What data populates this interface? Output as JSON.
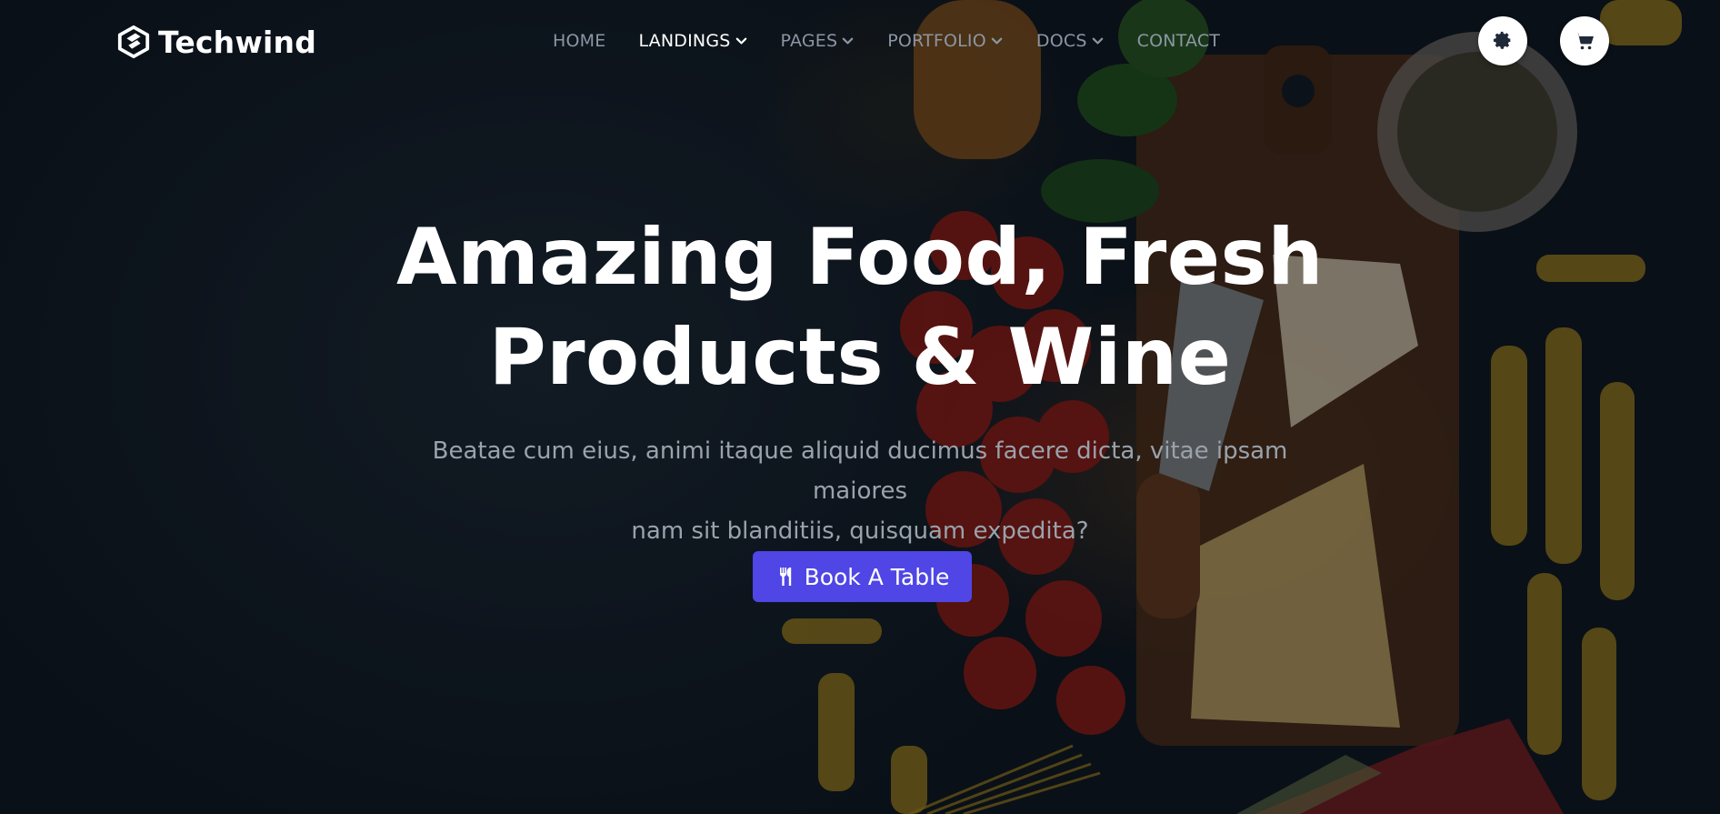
{
  "brand": {
    "name": "Techwind",
    "accent": "#4f46e5"
  },
  "nav": {
    "items": [
      {
        "label": "HOME",
        "active": false,
        "has_dropdown": false
      },
      {
        "label": "LANDINGS",
        "active": true,
        "has_dropdown": true
      },
      {
        "label": "PAGES",
        "active": false,
        "has_dropdown": true
      },
      {
        "label": "PORTFOLIO",
        "active": false,
        "has_dropdown": true
      },
      {
        "label": "DOCS",
        "active": false,
        "has_dropdown": true
      },
      {
        "label": "CONTACT",
        "active": false,
        "has_dropdown": false
      }
    ]
  },
  "header_buttons": {
    "settings_icon": "gear-icon",
    "cart_icon": "shopping-cart-icon"
  },
  "hero": {
    "title_line1": "Amazing Food, Fresh",
    "title_line2": "Products & Wine",
    "subtitle_line1": "Beatae cum eius, animi itaque aliquid ducimus facere dicta, vitae ipsam maiores",
    "subtitle_line2": "nam sit blanditiis, quisquam expedita?",
    "cta_label": "Book A Table",
    "cta_icon": "utensils-icon"
  }
}
